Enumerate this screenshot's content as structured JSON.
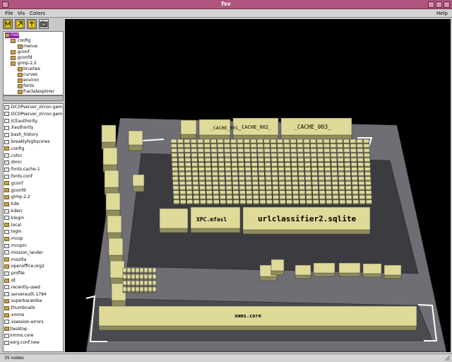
{
  "window": {
    "title": "fsv"
  },
  "menubar": {
    "items": [
      {
        "label": "File"
      },
      {
        "label": "Vis"
      },
      {
        "label": "Colors"
      },
      {
        "label": "Help"
      }
    ]
  },
  "toolbar": {
    "buttons": [
      {
        "icon": "cd-root-icon"
      },
      {
        "icon": "cd-up-icon"
      },
      {
        "icon": "bird-eye-icon"
      },
      {
        "icon": "camera-icon"
      }
    ]
  },
  "tree": {
    "rows": [
      {
        "label": "root",
        "level": 0,
        "selected": true
      },
      {
        "label": ".config",
        "level": 1,
        "selected": false
      },
      {
        "label": "menus",
        "level": 2,
        "selected": false
      },
      {
        "label": ".gconf",
        "level": 1,
        "selected": false
      },
      {
        "label": ".gconfd",
        "level": 1,
        "selected": false
      },
      {
        "label": ".gimp-2.2",
        "level": 1,
        "selected": false
      },
      {
        "label": "brushes",
        "level": 2,
        "selected": false
      },
      {
        "label": "curves",
        "level": 2,
        "selected": false
      },
      {
        "label": "environ",
        "level": 2,
        "selected": false
      },
      {
        "label": "fonts",
        "level": 2,
        "selected": false
      },
      {
        "label": "fractalexplorer",
        "level": 2,
        "selected": false
      }
    ]
  },
  "list": {
    "rows": [
      {
        "label": ".DCOPserver_zircon.gem",
        "kind": "file"
      },
      {
        "label": ".DCOPserver_zircon.gem",
        "kind": "file"
      },
      {
        "label": ".ICEauthority",
        "kind": "file"
      },
      {
        "label": ".Xauthority",
        "kind": "file"
      },
      {
        "label": ".bash_history",
        "kind": "file"
      },
      {
        "label": ".breaklyhighscores",
        "kind": "file"
      },
      {
        "label": ".config",
        "kind": "folder"
      },
      {
        "label": ".cshrc",
        "kind": "file"
      },
      {
        "label": ".dmrc",
        "kind": "file"
      },
      {
        "label": ".fonts.cache-1",
        "kind": "file"
      },
      {
        "label": ".fonts.conf",
        "kind": "file"
      },
      {
        "label": ".gconf",
        "kind": "folder"
      },
      {
        "label": ".gconfd",
        "kind": "folder"
      },
      {
        "label": ".gimp-2.2",
        "kind": "folder"
      },
      {
        "label": ".kde",
        "kind": "folder"
      },
      {
        "label": ".kderc",
        "kind": "file"
      },
      {
        "label": ".klogin",
        "kind": "file"
      },
      {
        "label": ".local",
        "kind": "folder"
      },
      {
        "label": ".login",
        "kind": "file"
      },
      {
        "label": ".mcop",
        "kind": "folder"
      },
      {
        "label": ".mcoprc",
        "kind": "file"
      },
      {
        "label": ".mission_lander",
        "kind": "file"
      },
      {
        "label": ".mozilla",
        "kind": "folder"
      },
      {
        "label": ".openoffice.org2",
        "kind": "folder"
      },
      {
        "label": ".profile",
        "kind": "file"
      },
      {
        "label": ".qt",
        "kind": "folder"
      },
      {
        "label": ".recently-used",
        "kind": "file"
      },
      {
        "label": ".serverauth.1784",
        "kind": "file"
      },
      {
        "label": ".superkaramba",
        "kind": "folder"
      },
      {
        "label": ".thumbnails",
        "kind": "folder"
      },
      {
        "label": ".xmms",
        "kind": "folder"
      },
      {
        "label": ".xsession-errors",
        "kind": "file"
      },
      {
        "label": "Desktop",
        "kind": "folder"
      },
      {
        "label": "xmms.core",
        "kind": "file"
      },
      {
        "label": "xorg.conf.new",
        "kind": "file"
      }
    ]
  },
  "viewport": {
    "labels": {
      "cache_001": "_CACHE_001_",
      "cache_002": "_CACHE_002_",
      "cache_003": "_CACHE_003_",
      "mfasl": "XPC.mfasl",
      "sqlite": "urlclassifier2.sqlite",
      "xmms_core": "xmms.core"
    },
    "colors": {
      "block_top": "#e0da98",
      "block_side": "#8f8c5c",
      "floor": "#6e6e74",
      "floor_side": "#4a4a50",
      "dark_platform": "#3c3c40",
      "outline": "#ffffff"
    }
  },
  "status": {
    "text": "35 nodes"
  }
}
